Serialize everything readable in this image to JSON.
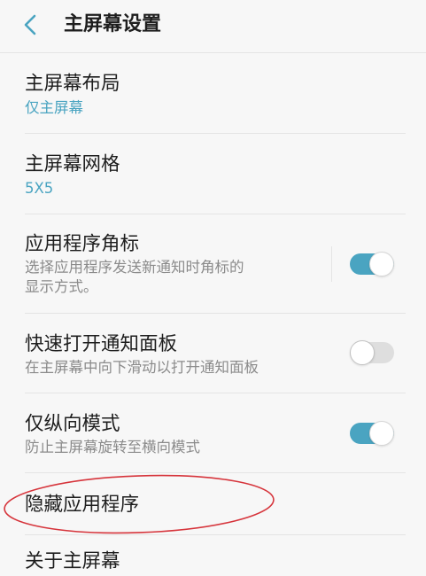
{
  "colors": {
    "accent": "#4aa4c1",
    "annotation": "#d6343b",
    "background": "#f7f7f7",
    "divider": "#e4e4e4",
    "title_text": "#1e1e1e",
    "secondary_text": "#8b8b8b",
    "toggle_off_track": "#dedede"
  },
  "header": {
    "back_icon": "chevron-left-icon",
    "title": "主屏幕设置"
  },
  "settings": [
    {
      "title": "主屏幕布局",
      "value": "仅主屏幕"
    },
    {
      "title": "主屏幕网格",
      "value": "5X5"
    },
    {
      "title": "应用程序角标",
      "description": "选择应用程序发送新通知时角标的显示方式。",
      "toggle_on": true
    },
    {
      "title": "快速打开通知面板",
      "description": "在主屏幕中向下滑动以打开通知面板",
      "toggle_on": false
    },
    {
      "title": "仅纵向模式",
      "description": "防止主屏幕旋转至横向模式",
      "toggle_on": true
    },
    {
      "title": "隐藏应用程序"
    },
    {
      "title": "关于主屏幕"
    }
  ]
}
